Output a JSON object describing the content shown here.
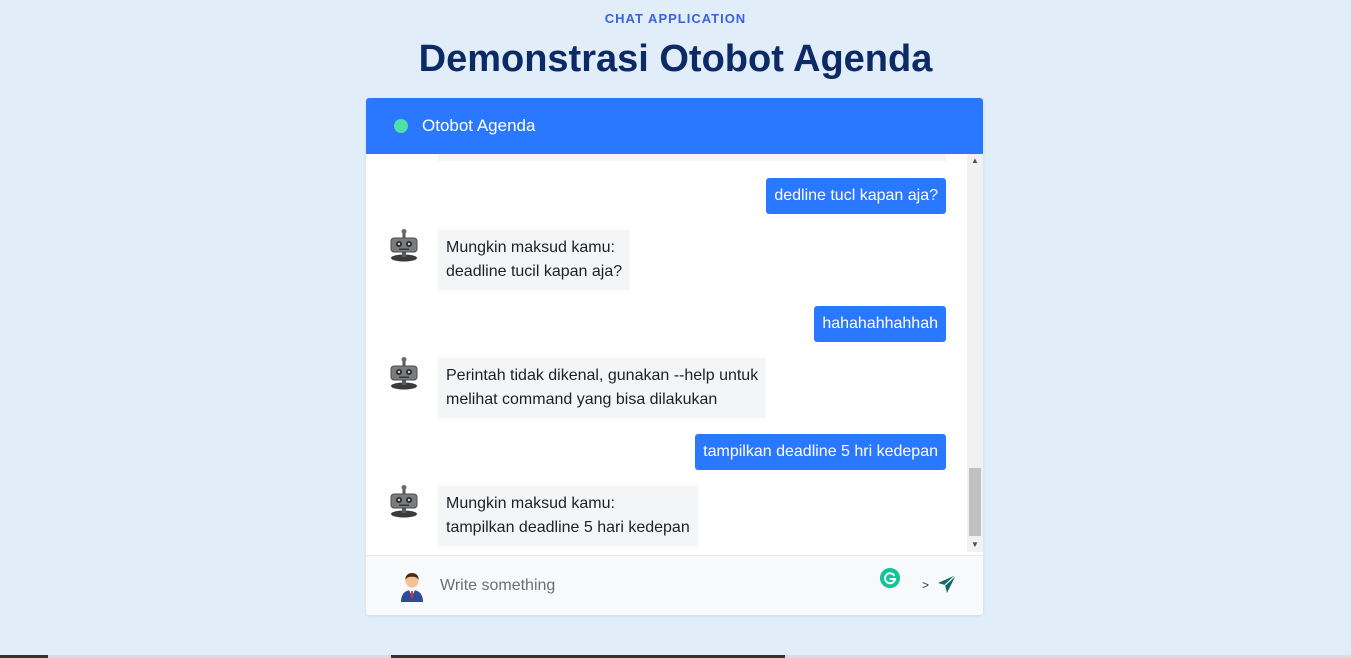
{
  "page": {
    "eyebrow": "CHAT APPLICATION",
    "title": "Demonstrasi Otobot Agenda"
  },
  "chat": {
    "header_title": "Otobot Agenda",
    "status_color": "#4fe0a8",
    "accent_color": "#2a78ff",
    "messages": [
      {
        "sender": "user",
        "lines": [
          "dedline tucl kapan aja?"
        ]
      },
      {
        "sender": "bot",
        "lines": [
          "Mungkin maksud kamu:",
          "deadline tucil kapan aja?"
        ]
      },
      {
        "sender": "user",
        "lines": [
          "hahahahhahhah"
        ]
      },
      {
        "sender": "bot",
        "lines": [
          "Perintah tidak dikenal, gunakan --help untuk",
          "melihat command yang bisa dilakukan"
        ]
      },
      {
        "sender": "user",
        "lines": [
          "tampilkan deadline 5 hri kedepan"
        ]
      },
      {
        "sender": "bot",
        "lines": [
          "Mungkin maksud kamu:",
          "tampilkan deadline 5 hari kedepan"
        ]
      }
    ]
  },
  "input": {
    "placeholder": "Write something",
    "value": "",
    "stray_glyph": ">",
    "send_icon": "paper-plane-icon",
    "grammarly_icon": "grammarly-icon"
  },
  "icons": {
    "bot_avatar": "robot-icon",
    "user_avatar": "user-avatar-icon"
  }
}
